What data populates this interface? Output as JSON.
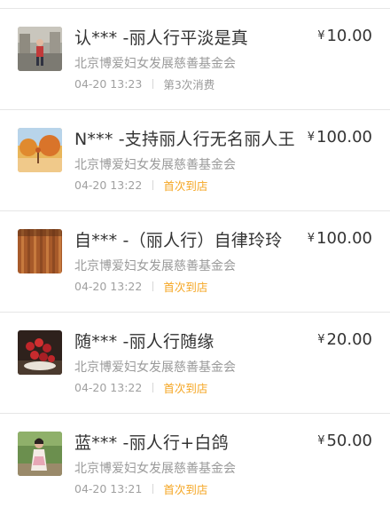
{
  "currency_symbol": "¥",
  "colors": {
    "first_visit_tag": "#f5a623",
    "divider": "#e6e6e6"
  },
  "items": [
    {
      "title": "认*** -丽人行平淡是真",
      "org": "北京博爱妇女发展慈善基金会",
      "time": "04-20 13:23",
      "tag": "第3次消费",
      "tag_style": "gray",
      "amount": "10.00",
      "avatar_icon": "person-photo-avatar"
    },
    {
      "title": "N*** -支持丽人行无名丽人王",
      "org": "北京博爱妇女发展慈善基金会",
      "time": "04-20 13:22",
      "tag": "首次到店",
      "tag_style": "orange",
      "amount": "100.00",
      "avatar_icon": "autumn-scene-avatar"
    },
    {
      "title": "自*** -（丽人行）自律玲玲",
      "org": "北京博爱妇女发展慈善基金会",
      "time": "04-20 13:22",
      "tag": "首次到店",
      "tag_style": "orange",
      "amount": "100.00",
      "avatar_icon": "woven-texture-avatar"
    },
    {
      "title": "随*** -丽人行随缘",
      "org": "北京博爱妇女发展慈善基金会",
      "time": "04-20 13:22",
      "tag": "首次到店",
      "tag_style": "orange",
      "amount": "20.00",
      "avatar_icon": "cherries-avatar"
    },
    {
      "title": "蓝*** -丽人行+白鸽",
      "org": "北京博爱妇女发展慈善基金会",
      "time": "04-20 13:21",
      "tag": "首次到店",
      "tag_style": "orange",
      "amount": "50.00",
      "avatar_icon": "woman-outdoor-avatar"
    }
  ]
}
